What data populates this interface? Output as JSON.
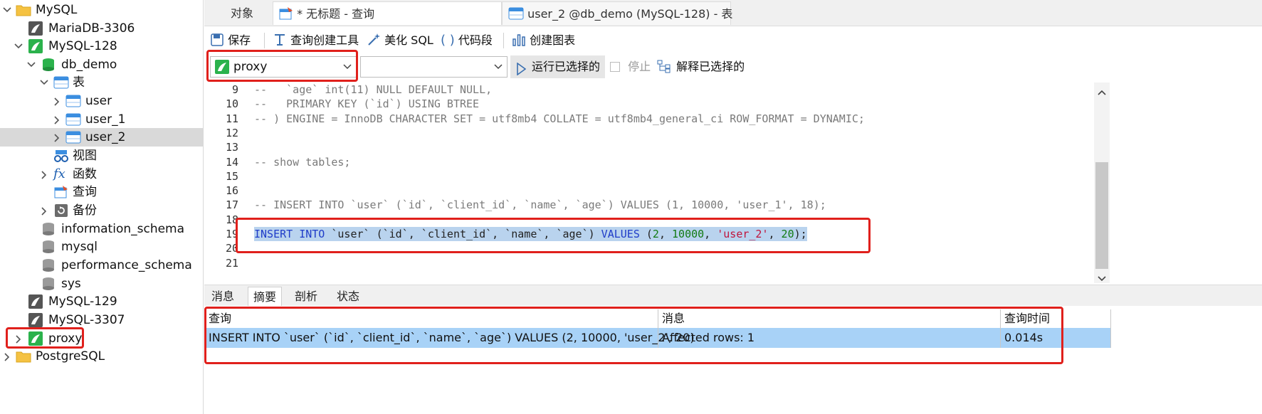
{
  "sidebar": {
    "items": [
      {
        "label": "MySQL"
      },
      {
        "label": "MariaDB-3306"
      },
      {
        "label": "MySQL-128"
      },
      {
        "label": "db_demo"
      },
      {
        "label": "表"
      },
      {
        "label": "user"
      },
      {
        "label": "user_1"
      },
      {
        "label": "user_2"
      },
      {
        "label": "视图"
      },
      {
        "label": "函数"
      },
      {
        "label": "查询"
      },
      {
        "label": "备份"
      },
      {
        "label": "information_schema"
      },
      {
        "label": "mysql"
      },
      {
        "label": "performance_schema"
      },
      {
        "label": "sys"
      },
      {
        "label": "MySQL-129"
      },
      {
        "label": "MySQL-3307"
      },
      {
        "label": "proxy"
      },
      {
        "label": "PostgreSQL"
      }
    ]
  },
  "tabs": {
    "objects": "对象",
    "query_tab": "* 无标题 - 查询",
    "table_tab": "user_2 @db_demo (MySQL-128) - 表"
  },
  "toolbar": {
    "save": "保存",
    "query_builder": "查询创建工具",
    "beautify": "美化 SQL",
    "snippet": "代码段",
    "create_chart": "创建图表"
  },
  "connbar": {
    "connection": "proxy",
    "database": "",
    "run_selected": "运行已选择的",
    "stop": "停止",
    "explain_selected": "解释已选择的"
  },
  "editor": {
    "lines": [
      {
        "n": "9",
        "text": "--   `age` int(11) NULL DEFAULT NULL,"
      },
      {
        "n": "10",
        "text": "--   PRIMARY KEY (`id`) USING BTREE"
      },
      {
        "n": "11",
        "text": "-- ) ENGINE = InnoDB CHARACTER SET = utf8mb4 COLLATE = utf8mb4_general_ci ROW_FORMAT = DYNAMIC;"
      },
      {
        "n": "12",
        "text": ""
      },
      {
        "n": "13",
        "text": ""
      },
      {
        "n": "14",
        "text": "-- show tables;"
      },
      {
        "n": "15",
        "text": ""
      },
      {
        "n": "16",
        "text": ""
      },
      {
        "n": "17",
        "text": "-- INSERT INTO `user` (`id`, `client_id`, `name`, `age`) VALUES (1, 10000, 'user_1', 18);"
      },
      {
        "n": "18",
        "text": ""
      },
      {
        "n": "19",
        "text": "INSERT INTO `user` (`id`, `client_id`, `name`, `age`) VALUES (2, 10000, 'user_2', 20);"
      },
      {
        "n": "20",
        "text": ""
      },
      {
        "n": "21",
        "text": ""
      }
    ]
  },
  "result_tabs": [
    "消息",
    "摘要",
    "剖析",
    "状态"
  ],
  "result_grid": {
    "headers": [
      "查询",
      "消息",
      "查询时间"
    ],
    "row": [
      "INSERT INTO `user` (`id`, `client_id`, `name`, `age`) VALUES (2, 10000, 'user_2', 20)",
      "Affected rows: 1",
      "0.014s"
    ]
  },
  "colors": {
    "selection": "#b9d3ee",
    "row_highlight": "#a8d2f7",
    "annotation_red": "#e0201c",
    "connection_green": "#2bb24c"
  }
}
